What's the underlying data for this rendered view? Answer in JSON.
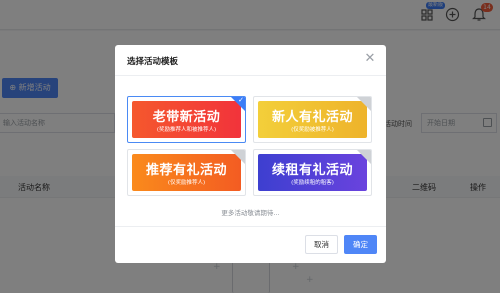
{
  "topbar": {
    "badge_new": "最新版",
    "notify_count": "14",
    "icons": [
      "app-grid-icon",
      "add-circle-icon",
      "bell-icon"
    ]
  },
  "page": {
    "add_button": "新增活动",
    "search_placeholder": "输入活动名称",
    "time_label": "活动时间",
    "date_placeholder": "开始日期",
    "columns": [
      "活动名称",
      "二维码",
      "操作"
    ]
  },
  "modal": {
    "title": "选择活动模板",
    "templates": [
      {
        "title": "老带新活动",
        "subtitle": "(奖励推荐人和被推荐人)",
        "selected": true,
        "color": "#f24a2b"
      },
      {
        "title": "新人有礼活动",
        "subtitle": "(仅奖励被推荐人)",
        "selected": false,
        "color": "#f1c232"
      },
      {
        "title": "推荐有礼活动",
        "subtitle": "(仅奖励推荐人)",
        "selected": false,
        "color": "#f57a1f"
      },
      {
        "title": "续租有礼活动",
        "subtitle": "(奖励续租的租客)",
        "selected": false,
        "color": "#4c4fd8"
      }
    ],
    "more_text": "更多活动敬请期待...",
    "cancel_label": "取消",
    "ok_label": "确定"
  },
  "colors": {
    "primary": "#4f86f7",
    "accent_blue": "#3c7df7",
    "badge_red": "#f25c3a"
  }
}
